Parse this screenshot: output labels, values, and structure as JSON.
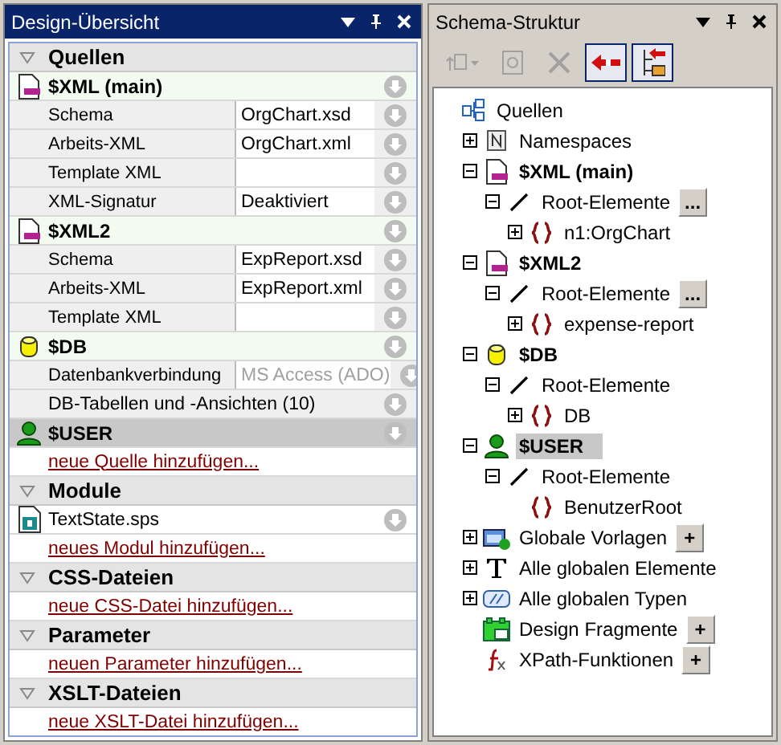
{
  "design_overview": {
    "title": "Design-Übersicht",
    "active": true,
    "sections": [
      {
        "title": "Quellen",
        "expanded": true,
        "items": [
          {
            "kind": "xml",
            "label": "$XML (main)",
            "selected": false
          },
          {
            "kind": "property",
            "label": "Schema",
            "value": "OrgChart.xsd",
            "disabled": false
          },
          {
            "kind": "property",
            "label": "Arbeits-XML",
            "value": "OrgChart.xml",
            "disabled": false
          },
          {
            "kind": "property",
            "label": "Template XML",
            "disabled": false
          },
          {
            "kind": "property",
            "label": "XML-Signatur",
            "value": "Deaktiviert",
            "disabled": false
          },
          {
            "kind": "xml",
            "label": "$XML2",
            "selected": false
          },
          {
            "kind": "property",
            "label": "Schema",
            "value": "ExpReport.xsd",
            "disabled": false
          },
          {
            "kind": "property",
            "label": "Arbeits-XML",
            "value": "ExpReport.xml",
            "disabled": false
          },
          {
            "kind": "property",
            "label": "Template XML",
            "disabled": false
          },
          {
            "kind": "db",
            "label": "$DB",
            "selected": false
          },
          {
            "kind": "property",
            "label": "Datenbankverbindung",
            "value": "MS Access (ADO)",
            "disabled": true
          },
          {
            "kind": "wide",
            "label": "DB-Tabellen und -Ansichten (10)"
          },
          {
            "kind": "user",
            "label": "$USER",
            "selected": true
          },
          {
            "kind": "link",
            "label": "neue Quelle hinzufügen..."
          }
        ]
      },
      {
        "title": "Module",
        "expanded": true,
        "items": [
          {
            "kind": "file",
            "label": "TextState.sps"
          },
          {
            "kind": "link",
            "label": "neues Modul hinzufügen..."
          }
        ]
      },
      {
        "title": "CSS-Dateien",
        "expanded": true,
        "items": [
          {
            "kind": "link",
            "label": "neue CSS-Datei hinzufügen..."
          }
        ]
      },
      {
        "title": "Parameter",
        "expanded": true,
        "items": [
          {
            "kind": "link",
            "label": "neuen Parameter hinzufügen..."
          }
        ]
      },
      {
        "title": "XSLT-Dateien",
        "expanded": true,
        "items": [
          {
            "kind": "link",
            "label": "neue XSLT-Datei hinzufügen..."
          }
        ]
      }
    ]
  },
  "schema_tree": {
    "title": "Schema-Struktur",
    "active": false,
    "toolbar": [
      {
        "kind": "add-element",
        "disabled": true,
        "on": false
      },
      {
        "kind": "properties",
        "disabled": true,
        "on": false
      },
      {
        "kind": "delete",
        "disabled": true,
        "on": false
      },
      {
        "kind": "tag",
        "disabled": false,
        "on": true
      },
      {
        "kind": "tree-tag",
        "disabled": false,
        "on": true
      }
    ],
    "nodes": [
      {
        "label": "Quellen",
        "kind": "sources",
        "bold": false,
        "selected": false,
        "children": [
          {
            "label": "Namespaces",
            "kind": "namespace",
            "bold": false,
            "selected": false,
            "expanded": false
          },
          {
            "label": "$XML (main)",
            "kind": "xml",
            "bold": true,
            "selected": false,
            "expanded": true,
            "children": [
              {
                "label": "Root-Elemente",
                "kind": "root",
                "bold": false,
                "selected": false,
                "expanded": true,
                "button": "...",
                "children": [
                  {
                    "label": "n1:OrgChart",
                    "kind": "element",
                    "bold": false,
                    "selected": false,
                    "expanded": false
                  }
                ]
              }
            ]
          },
          {
            "label": "$XML2",
            "kind": "xml",
            "bold": true,
            "selected": false,
            "expanded": true,
            "children": [
              {
                "label": "Root-Elemente",
                "kind": "root",
                "bold": false,
                "selected": false,
                "expanded": true,
                "button": "...",
                "children": [
                  {
                    "label": "expense-report",
                    "kind": "element",
                    "bold": false,
                    "selected": false,
                    "expanded": false
                  }
                ]
              }
            ]
          },
          {
            "label": "$DB",
            "kind": "db",
            "bold": true,
            "selected": false,
            "expanded": true,
            "children": [
              {
                "label": "Root-Elemente",
                "kind": "root",
                "bold": false,
                "selected": false,
                "expanded": true,
                "children": [
                  {
                    "label": "DB",
                    "kind": "element",
                    "bold": false,
                    "selected": false,
                    "expanded": false
                  }
                ]
              }
            ]
          },
          {
            "label": "$USER",
            "kind": "user",
            "bold": true,
            "selected": true,
            "expanded": true,
            "children": [
              {
                "label": "Root-Elemente",
                "kind": "root",
                "bold": false,
                "selected": false,
                "expanded": true,
                "children": [
                  {
                    "label": "BenutzerRoot",
                    "kind": "element",
                    "bold": false,
                    "selected": false
                  }
                ]
              }
            ]
          },
          {
            "label": "Globale Vorlagen",
            "kind": "templates",
            "bold": false,
            "selected": false,
            "expanded": false,
            "button": "+"
          },
          {
            "label": "Alle globalen Elemente",
            "kind": "elements",
            "bold": false,
            "selected": false,
            "expanded": false
          },
          {
            "label": "Alle globalen Typen",
            "kind": "types",
            "bold": false,
            "selected": false,
            "expanded": false
          },
          {
            "label": "Design Fragmente",
            "kind": "fragments",
            "bold": false,
            "selected": false,
            "button": "+"
          },
          {
            "label": "XPath-Funktionen",
            "kind": "functions",
            "bold": false,
            "selected": false,
            "button": "+"
          }
        ]
      }
    ]
  }
}
